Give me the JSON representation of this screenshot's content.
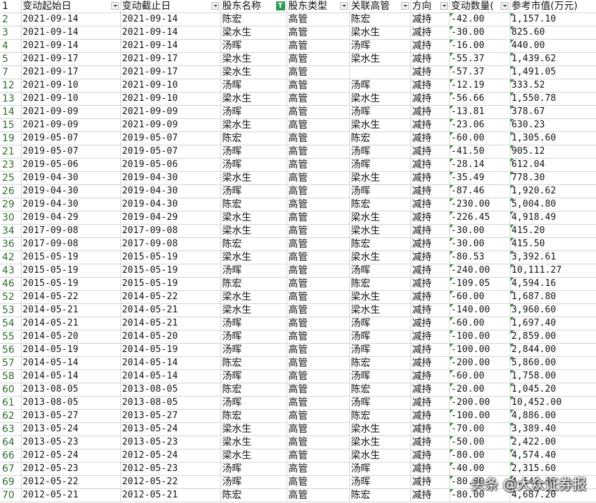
{
  "headers": {
    "row_num": "1",
    "cols": [
      "变动起始日",
      "变动截止日",
      "股东名称",
      "股东类型",
      "关联高管",
      "方向",
      "变动数量(",
      "参考市值(万元)"
    ],
    "filter_active_icon_text": "T"
  },
  "rows": [
    {
      "n": "2",
      "c": [
        "2021-09-14",
        "2021-09-14",
        "陈宏",
        "高管",
        "陈宏",
        "减持",
        "-42.00",
        "1,157.10"
      ]
    },
    {
      "n": "3",
      "c": [
        "2021-09-14",
        "2021-09-14",
        "梁水生",
        "高管",
        "梁水生",
        "减持",
        "-30.00",
        "825.60"
      ]
    },
    {
      "n": "4",
      "c": [
        "2021-09-14",
        "2021-09-14",
        "汤晖",
        "高管",
        "汤晖",
        "减持",
        "-16.00",
        "440.00"
      ]
    },
    {
      "n": "5",
      "c": [
        "2021-09-17",
        "2021-09-17",
        "梁水生",
        "高管",
        "梁水生",
        "减持",
        "-55.37",
        "1,439.62"
      ]
    },
    {
      "n": "7",
      "c": [
        "2021-09-17",
        "2021-09-17",
        "梁水生",
        "高管",
        "",
        "减持",
        "-57.37",
        "1,491.05"
      ]
    },
    {
      "n": "12",
      "c": [
        "2021-09-10",
        "2021-09-10",
        "汤晖",
        "高管",
        "汤晖",
        "减持",
        "-12.19",
        "333.52"
      ]
    },
    {
      "n": "13",
      "c": [
        "2021-09-10",
        "2021-09-10",
        "梁水生",
        "高管",
        "梁水生",
        "减持",
        "-56.66",
        "1,550.78"
      ]
    },
    {
      "n": "14",
      "c": [
        "2021-09-09",
        "2021-09-09",
        "汤晖",
        "高管",
        "汤晖",
        "减持",
        "-13.81",
        "378.67"
      ]
    },
    {
      "n": "15",
      "c": [
        "2021-09-09",
        "2021-09-09",
        "梁水生",
        "高管",
        "梁水生",
        "减持",
        "-23.06",
        "630.23"
      ]
    },
    {
      "n": "19",
      "c": [
        "2019-05-07",
        "2019-05-07",
        "陈宏",
        "高管",
        "陈宏",
        "减持",
        "-60.00",
        "1,305.60"
      ]
    },
    {
      "n": "21",
      "c": [
        "2019-05-07",
        "2019-05-07",
        "汤晖",
        "高管",
        "汤晖",
        "减持",
        "-41.50",
        "905.12"
      ]
    },
    {
      "n": "23",
      "c": [
        "2019-05-06",
        "2019-05-06",
        "汤晖",
        "高管",
        "汤晖",
        "减持",
        "-28.14",
        "612.04"
      ]
    },
    {
      "n": "25",
      "c": [
        "2019-04-30",
        "2019-04-30",
        "梁水生",
        "高管",
        "梁水生",
        "减持",
        "-35.49",
        "778.30"
      ]
    },
    {
      "n": "26",
      "c": [
        "2019-04-30",
        "2019-04-30",
        "汤晖",
        "高管",
        "汤晖",
        "减持",
        "-87.46",
        "1,920.62"
      ]
    },
    {
      "n": "29",
      "c": [
        "2019-04-30",
        "2019-04-30",
        "陈宏",
        "高管",
        "陈宏",
        "减持",
        "-230.00",
        "5,004.80"
      ]
    },
    {
      "n": "30",
      "c": [
        "2019-04-29",
        "2019-04-29",
        "梁水生",
        "高管",
        "梁水生",
        "减持",
        "-226.45",
        "4,918.49"
      ]
    },
    {
      "n": "34",
      "c": [
        "2017-09-08",
        "2017-09-08",
        "梁水生",
        "高管",
        "梁水生",
        "减持",
        "-30.00",
        "415.20"
      ]
    },
    {
      "n": "36",
      "c": [
        "2017-09-08",
        "2017-09-08",
        "陈宏",
        "高管",
        "陈宏",
        "减持",
        "-30.00",
        "415.50"
      ]
    },
    {
      "n": "42",
      "c": [
        "2015-05-19",
        "2015-05-19",
        "梁水生",
        "高管",
        "梁水生",
        "减持",
        "-80.53",
        "3,392.61"
      ]
    },
    {
      "n": "43",
      "c": [
        "2015-05-19",
        "2015-05-19",
        "汤晖",
        "高管",
        "汤晖",
        "减持",
        "-240.00",
        "10,111.27"
      ]
    },
    {
      "n": "46",
      "c": [
        "2015-05-19",
        "2015-05-19",
        "陈宏",
        "高管",
        "陈宏",
        "减持",
        "-109.05",
        "4,594.16"
      ]
    },
    {
      "n": "52",
      "c": [
        "2014-05-22",
        "2014-05-22",
        "梁水生",
        "高管",
        "梁水生",
        "减持",
        "-60.00",
        "1,687.80"
      ]
    },
    {
      "n": "53",
      "c": [
        "2014-05-21",
        "2014-05-21",
        "梁水生",
        "高管",
        "梁水生",
        "减持",
        "-140.00",
        "3,960.60"
      ]
    },
    {
      "n": "54",
      "c": [
        "2014-05-21",
        "2014-05-21",
        "汤晖",
        "高管",
        "汤晖",
        "减持",
        "-60.00",
        "1,697.40"
      ]
    },
    {
      "n": "55",
      "c": [
        "2014-05-20",
        "2014-05-20",
        "汤晖",
        "高管",
        "汤晖",
        "减持",
        "-100.00",
        "2,859.00"
      ]
    },
    {
      "n": "56",
      "c": [
        "2014-05-19",
        "2014-05-19",
        "汤晖",
        "高管",
        "汤晖",
        "减持",
        "-100.00",
        "2,844.00"
      ]
    },
    {
      "n": "57",
      "c": [
        "2014-05-14",
        "2014-05-14",
        "陈宏",
        "高管",
        "陈宏",
        "减持",
        "-200.00",
        "5,860.00"
      ]
    },
    {
      "n": "58",
      "c": [
        "2014-05-14",
        "2014-05-14",
        "汤晖",
        "高管",
        "汤晖",
        "减持",
        "-60.00",
        "1,758.00"
      ]
    },
    {
      "n": "60",
      "c": [
        "2013-08-05",
        "2013-08-05",
        "陈宏",
        "高管",
        "陈宏",
        "减持",
        "-20.00",
        "1,045.20"
      ]
    },
    {
      "n": "61",
      "c": [
        "2013-08-05",
        "2013-08-05",
        "汤晖",
        "高管",
        "汤晖",
        "减持",
        "-200.00",
        "10,452.00"
      ]
    },
    {
      "n": "62",
      "c": [
        "2013-05-27",
        "2013-05-27",
        "陈宏",
        "高管",
        "陈宏",
        "减持",
        "-100.00",
        "4,886.00"
      ]
    },
    {
      "n": "63",
      "c": [
        "2013-05-24",
        "2013-05-24",
        "梁水生",
        "高管",
        "梁水生",
        "减持",
        "-70.00",
        "3,389.40"
      ]
    },
    {
      "n": "64",
      "c": [
        "2013-05-23",
        "2013-05-23",
        "梁水生",
        "高管",
        "梁水生",
        "减持",
        "-50.00",
        "2,422.00"
      ]
    },
    {
      "n": "66",
      "c": [
        "2012-05-24",
        "2012-05-24",
        "梁水生",
        "高管",
        "梁水生",
        "减持",
        "-80.00",
        "4,574.40"
      ]
    },
    {
      "n": "67",
      "c": [
        "2012-05-23",
        "2012-05-23",
        "汤晖",
        "高管",
        "汤晖",
        "减持",
        "-40.00",
        "2,315.60"
      ]
    },
    {
      "n": "69",
      "c": [
        "2012-05-22",
        "2012-05-22",
        "汤晖",
        "高管",
        "汤晖",
        "减持",
        "-80.00",
        "4,642.40"
      ]
    },
    {
      "n": "70",
      "c": [
        "2012-05-21",
        "2012-05-21",
        "陈宏",
        "高管",
        "陈宏",
        "减持",
        "-80.00",
        "4,687.20"
      ]
    }
  ],
  "watermark": "头条 @大众证券报",
  "colors": {
    "grid": "#d4d4d4",
    "row_num_text": "#2f6b2f",
    "filter_active": "#2e9b5a",
    "number_marker": "#2f8a3a"
  }
}
